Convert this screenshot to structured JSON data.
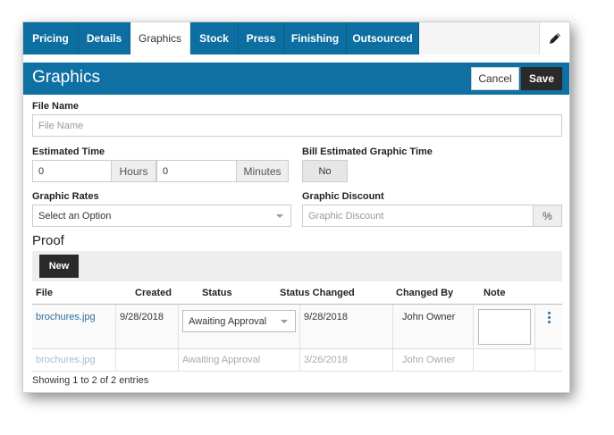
{
  "tabs": [
    {
      "label": "Pricing"
    },
    {
      "label": "Details"
    },
    {
      "label": "Graphics"
    },
    {
      "label": "Stock"
    },
    {
      "label": "Press"
    },
    {
      "label": "Finishing"
    },
    {
      "label": "Outsourced"
    }
  ],
  "active_tab": "Graphics",
  "header": {
    "title": "Graphics",
    "cancel_label": "Cancel",
    "save_label": "Save"
  },
  "form": {
    "file_name_label": "File Name",
    "file_name_placeholder": "File Name",
    "estimated_time_label": "Estimated Time",
    "hours_value": "0",
    "hours_addon": "Hours",
    "minutes_value": "0",
    "minutes_addon": "Minutes",
    "bill_label": "Bill Estimated Graphic Time",
    "bill_value": "No",
    "rates_label": "Graphic Rates",
    "rates_value": "Select an Option",
    "discount_label": "Graphic Discount",
    "discount_placeholder": "Graphic Discount",
    "discount_addon": "%"
  },
  "proof": {
    "title": "Proof",
    "new_label": "New",
    "columns": [
      "File",
      "Created",
      "Status",
      "Status Changed",
      "Changed By",
      "Note"
    ],
    "rows": [
      {
        "file": "brochures.jpg",
        "created": "9/28/2018",
        "status": "Awaiting Approval",
        "status_changed": "9/28/2018",
        "changed_by": "John Owner"
      },
      {
        "file": "brochures.jpg",
        "created": "",
        "status": "Awaiting Approval",
        "status_changed": "3/26/2018",
        "changed_by": "John Owner"
      }
    ],
    "footer": "Showing 1 to 2 of 2 entries"
  },
  "colors": {
    "tab_blue": "#0d6ea1",
    "header_blue": "#0e70a3",
    "dark_button": "#2a2a2a",
    "link": "#2d6ea0"
  },
  "icons": {
    "edit": "pencil-icon",
    "row_menu": "kebab-menu-icon",
    "dropdown": "chevron-down-icon"
  }
}
